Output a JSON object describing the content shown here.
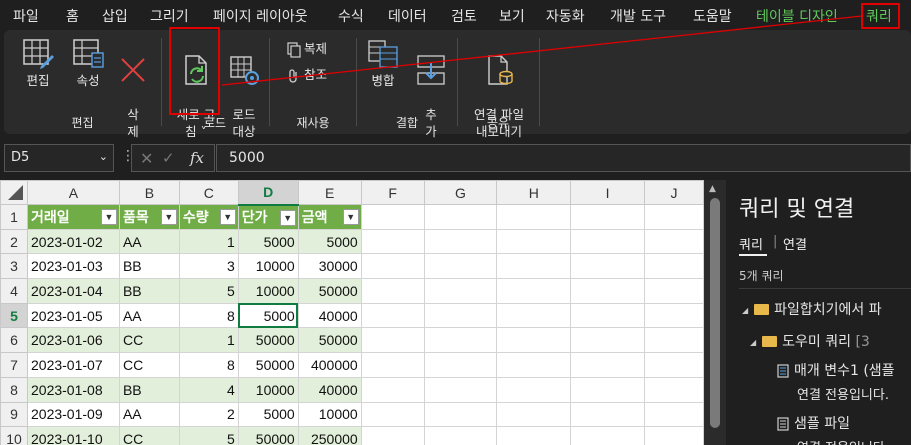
{
  "menu": {
    "items": [
      "파일",
      "홈",
      "삽입",
      "그리기",
      "페이지 레이아웃",
      "수식",
      "데이터",
      "검토",
      "보기",
      "자동화",
      "개발 도구",
      "도움말"
    ],
    "table_design": "테이블 디자인",
    "query": "쿼리"
  },
  "ribbon": {
    "edit_group": {
      "label": "편집",
      "edit": "편집",
      "properties": "속성",
      "delete": "삭\n제"
    },
    "load_group": {
      "label": "로드",
      "refresh": "새로 고\n침 ˅",
      "load_to": "로드\n대상"
    },
    "reuse_group": {
      "label": "재사용",
      "duplicate": "복제",
      "reference": "참조"
    },
    "combine_group": {
      "label": "결합",
      "merge": "병합",
      "append": "추\n가"
    },
    "share_group": {
      "label": "공유",
      "export": "연결 파일\n내보내기"
    }
  },
  "formula_bar": {
    "name_box": "D5",
    "fx": "fx",
    "value": "5000"
  },
  "sheet": {
    "columns": [
      "A",
      "B",
      "C",
      "D",
      "E",
      "F",
      "G",
      "H",
      "I",
      "J"
    ],
    "row_numbers": [
      "1",
      "2",
      "3",
      "4",
      "5",
      "6",
      "7",
      "8",
      "9",
      "10"
    ],
    "headers": [
      "거래일",
      "품목",
      "수량",
      "단가",
      "금액"
    ],
    "rows": [
      [
        "2023-01-02",
        "AA",
        "1",
        "5000",
        "5000"
      ],
      [
        "2023-01-03",
        "BB",
        "3",
        "10000",
        "30000"
      ],
      [
        "2023-01-04",
        "BB",
        "5",
        "10000",
        "50000"
      ],
      [
        "2023-01-05",
        "AA",
        "8",
        "5000",
        "40000"
      ],
      [
        "2023-01-06",
        "CC",
        "1",
        "50000",
        "50000"
      ],
      [
        "2023-01-07",
        "CC",
        "8",
        "50000",
        "400000"
      ],
      [
        "2023-01-08",
        "BB",
        "4",
        "10000",
        "40000"
      ],
      [
        "2023-01-09",
        "AA",
        "2",
        "5000",
        "10000"
      ],
      [
        "2023-01-10",
        "CC",
        "5",
        "50000",
        "250000"
      ]
    ],
    "selected_cell": "D5"
  },
  "queries_pane": {
    "title": "쿼리 및 연결",
    "tab_queries": "쿼리",
    "tab_connections": "연결",
    "count": "5개 쿼리",
    "folder1": "파일합치기에서 파",
    "folder2": "도우미 쿼리",
    "folder2_count": "[3",
    "item1": "매개 변수1 (샘플",
    "item1_sub": "연결 전용입니다.",
    "item2": "샘플 파일",
    "item2_sub": "연결 전용입니다."
  },
  "colors": {
    "accent_green": "#70ad47",
    "band_green": "#e2efda",
    "highlight_red": "#e00000",
    "excel_green": "#107c41"
  }
}
